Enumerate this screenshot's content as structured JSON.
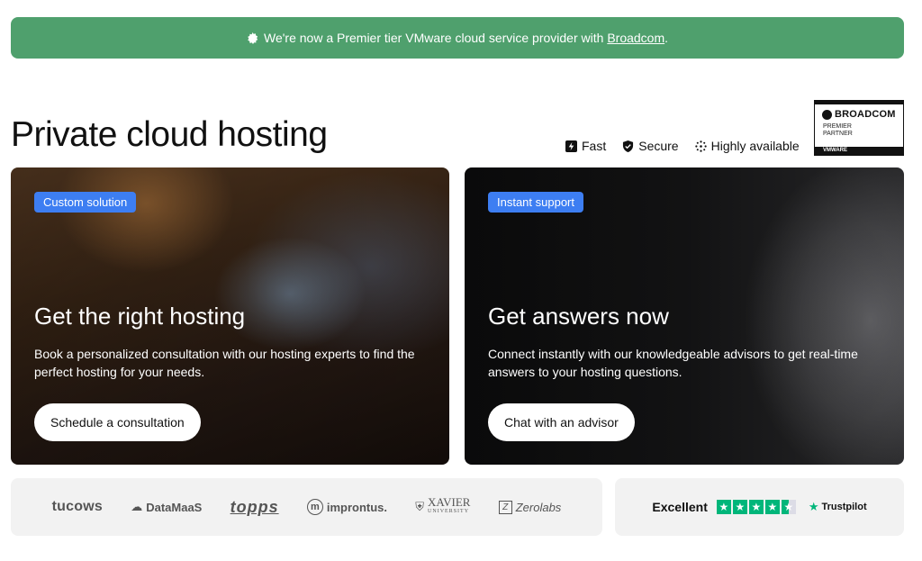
{
  "banner": {
    "text": "We're now a Premier tier VMware cloud service provider with ",
    "link": "Broadcom",
    "suffix": "."
  },
  "page": {
    "title": "Private cloud hosting"
  },
  "features": [
    {
      "label": "Fast",
      "icon": "lightning-icon"
    },
    {
      "label": "Secure",
      "icon": "shield-icon"
    },
    {
      "label": "Highly available",
      "icon": "dots-grid-icon"
    }
  ],
  "badge": {
    "brand": "BROADCOM",
    "line1": "PREMIER",
    "line2": "PARTNER",
    "foot": "VMWARE"
  },
  "cards": [
    {
      "tag": "Custom solution",
      "title": "Get the right hosting",
      "text": "Book a personalized consultation with our hosting experts to find the perfect hosting for your needs.",
      "button": "Schedule a consultation"
    },
    {
      "tag": "Instant support",
      "title": "Get answers now",
      "text": "Connect instantly with our knowledgeable advisors to get real-time answers to your hosting questions.",
      "button": "Chat with an advisor"
    }
  ],
  "logos": [
    "tucows",
    "DataMaaS",
    "topps",
    "improntus.",
    "XAVIER",
    "Zerolabs"
  ],
  "logos_sub": {
    "xavier": "UNIVERSITY"
  },
  "trust": {
    "rating_label": "Excellent",
    "stars": 4.5,
    "brand": "Trustpilot"
  },
  "colors": {
    "banner": "#4fa06d",
    "pill": "#3d7ef2",
    "trustpilot": "#00b67a"
  }
}
